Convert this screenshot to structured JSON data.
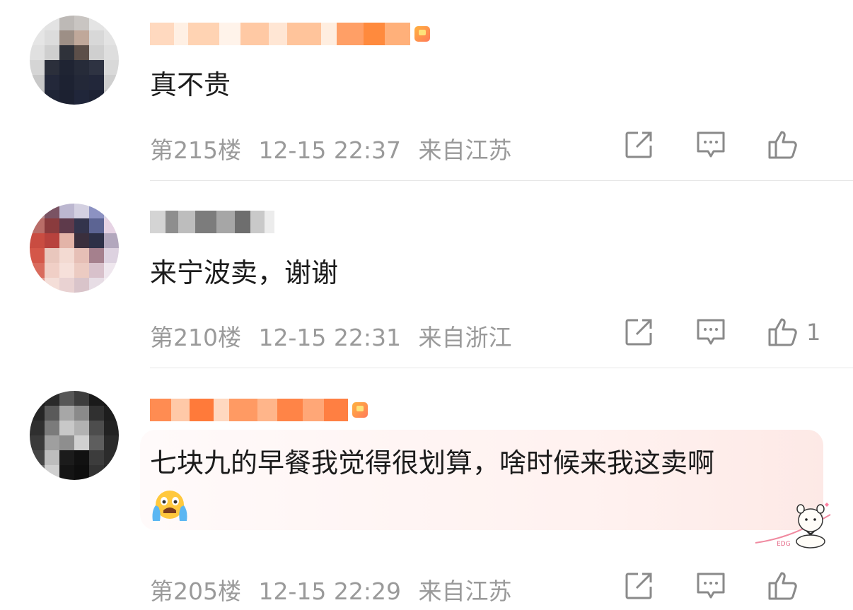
{
  "comments": [
    {
      "text": "真不贵",
      "floor": "第215楼",
      "datetime": "12-15 22:37",
      "location": "来自江苏",
      "likes": ""
    },
    {
      "text": "来宁波卖，谢谢",
      "floor": "第210楼",
      "datetime": "12-15 22:31",
      "location": "来自浙江",
      "likes": "1"
    },
    {
      "text": "七块九的早餐我觉得很划算，啥时候来我这卖啊",
      "emoji": "crying-face-emoji",
      "floor": "第205楼",
      "datetime": "12-15 22:29",
      "location": "来自江苏",
      "likes": ""
    }
  ],
  "sticker_text": "EDG",
  "colors": {
    "meta_gray": "#9a9a9a",
    "accent_orange": "#ff8a3d",
    "highlight": "#fff1ef"
  }
}
